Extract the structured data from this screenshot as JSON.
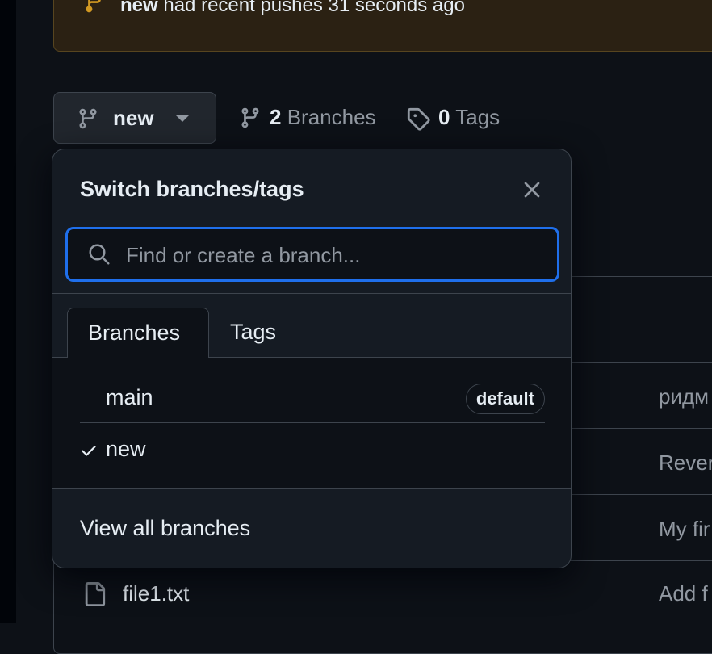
{
  "banner": {
    "branch": "new",
    "message": "had recent pushes 31 seconds ago"
  },
  "toolbar": {
    "current_branch": "new",
    "branches_count": "2",
    "branches_label": "Branches",
    "tags_count": "0",
    "tags_label": "Tags"
  },
  "popover": {
    "title": "Switch branches/tags",
    "search_placeholder": "Find or create a branch...",
    "tabs": [
      "Branches",
      "Tags"
    ],
    "branches": [
      {
        "name": "main",
        "badge": "default",
        "selected": false
      },
      {
        "name": "new",
        "badge": "",
        "selected": true
      }
    ],
    "view_all": "View all branches"
  },
  "files": {
    "rows": [
      {
        "name": "",
        "message": "ридм"
      },
      {
        "name": "",
        "message": "Rever"
      },
      {
        "name": "",
        "message": "My fir"
      },
      {
        "name": "file1.txt",
        "message": "Add f"
      }
    ]
  },
  "colors": {
    "accent": "#1f6feb",
    "banner_bg": "#2b2113",
    "banner_icon": "#d29922",
    "bg": "#0d1117"
  },
  "icons": [
    "git-branch-icon",
    "tag-icon",
    "search-icon",
    "close-icon",
    "check-icon",
    "caret-down-icon",
    "file-icon"
  ]
}
